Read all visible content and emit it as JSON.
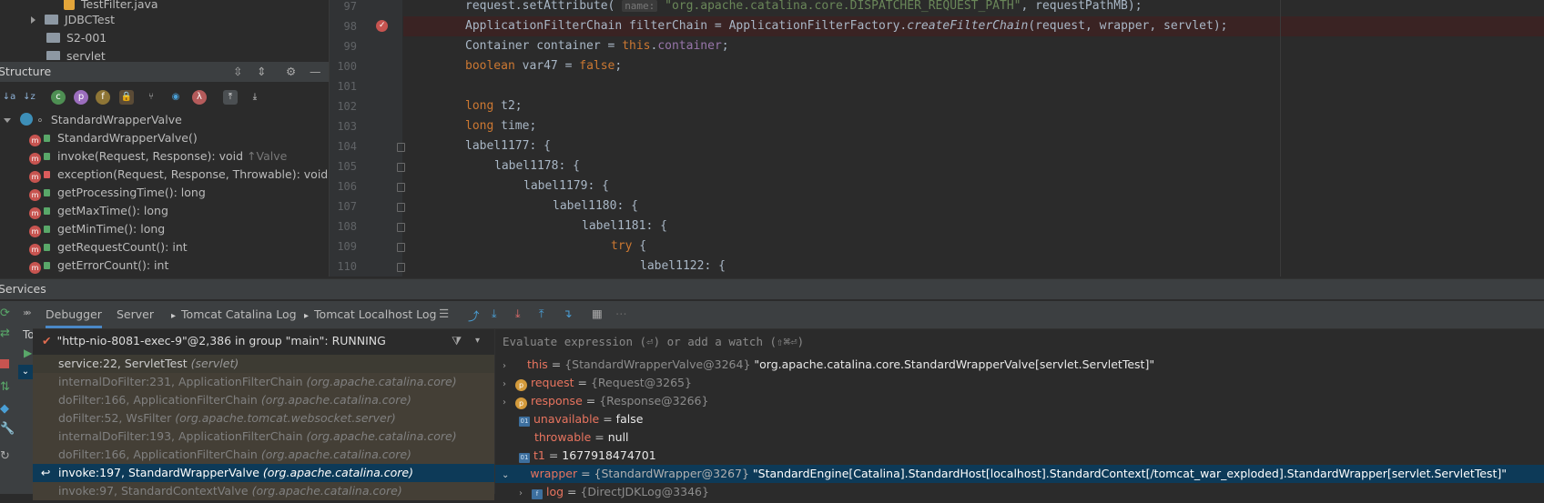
{
  "project_tree": [
    {
      "label": "TestFilter.java",
      "kind": "java-file"
    },
    {
      "label": "JDBCTest",
      "kind": "folder",
      "collapsed": true
    },
    {
      "label": "S2-001",
      "kind": "folder"
    },
    {
      "label": "servlet",
      "kind": "folder"
    }
  ],
  "structure": {
    "title": "Structure",
    "root": "StandardWrapperValve",
    "items": [
      {
        "label": "StandardWrapperValve()",
        "hint": "",
        "access": "public"
      },
      {
        "label": "invoke(Request, Response): void",
        "hint": "↑Valve",
        "access": "public"
      },
      {
        "label": "exception(Request, Response, Throwable): void",
        "hint": "",
        "access": "private"
      },
      {
        "label": "getProcessingTime(): long",
        "hint": "",
        "access": "public"
      },
      {
        "label": "getMaxTime(): long",
        "hint": "",
        "access": "public"
      },
      {
        "label": "getMinTime(): long",
        "hint": "",
        "access": "public"
      },
      {
        "label": "getRequestCount(): int",
        "hint": "",
        "access": "public"
      },
      {
        "label": "getErrorCount(): int",
        "hint": "",
        "access": "public"
      }
    ]
  },
  "editor": {
    "line_numbers": [
      "97",
      "98",
      "99",
      "100",
      "101",
      "102",
      "103",
      "104",
      "105",
      "106",
      "107",
      "108",
      "109",
      "110"
    ],
    "breakpoint_line": "98",
    "inlay_hint_name": "name:",
    "line97_str": "\"org.apache.catalina.core.DISPATCHER_REQUEST_PATH\"",
    "line97_rest": ", requestPathMB);",
    "line98_method": "createFilterChain",
    "line98_args": "(request, wrapper, servlet);",
    "labels": {
      "l1177": "label1177",
      "l1178": "label1178",
      "l1179": "label1179",
      "l1180": "label1180",
      "l1181": "label1181",
      "l1122": "label1122"
    }
  },
  "services": {
    "title": "Services",
    "tabs": [
      "Debugger",
      "Server",
      "Tomcat Catalina Log",
      "Tomcat Localhost Log"
    ],
    "active_tab": "Debugger",
    "side_label": "To"
  },
  "thread": {
    "label": "\"http-nio-8081-exec-9\"@2,386 in group \"main\": RUNNING"
  },
  "frames": [
    {
      "method": "service:22, ServletTest",
      "pkg": "(servlet)",
      "style": "user"
    },
    {
      "method": "internalDoFilter:231, ApplicationFilterChain",
      "pkg": "(org.apache.catalina.core)",
      "style": "lib"
    },
    {
      "method": "doFilter:166, ApplicationFilterChain",
      "pkg": "(org.apache.catalina.core)",
      "style": "lib"
    },
    {
      "method": "doFilter:52, WsFilter",
      "pkg": "(org.apache.tomcat.websocket.server)",
      "style": "lib"
    },
    {
      "method": "internalDoFilter:193, ApplicationFilterChain",
      "pkg": "(org.apache.catalina.core)",
      "style": "lib"
    },
    {
      "method": "doFilter:166, ApplicationFilterChain",
      "pkg": "(org.apache.catalina.core)",
      "style": "lib"
    },
    {
      "method": "invoke:197, StandardWrapperValve",
      "pkg": "(org.apache.catalina.core)",
      "style": "selected"
    },
    {
      "method": "invoke:97, StandardContextValve",
      "pkg": "(org.apache.catalina.core)",
      "style": "lib"
    }
  ],
  "watch": {
    "placeholder": "Evaluate expression (⏎) or add a watch (⇧⌘⏎)"
  },
  "variables": [
    {
      "name": "this",
      "type": "{StandardWrapperValve@3264}",
      "value": "\"org.apache.catalina.core.StandardWrapperValve[servlet.ServletTest]\"",
      "badge": "none",
      "expand": "right"
    },
    {
      "name": "request",
      "type": "{Request@3265}",
      "value": "",
      "badge": "p",
      "expand": "right"
    },
    {
      "name": "response",
      "type": "{Response@3266}",
      "value": "",
      "badge": "p",
      "expand": "right"
    },
    {
      "name": "unavailable",
      "type": "",
      "value": "false",
      "badge": "f",
      "expand": "none"
    },
    {
      "name": "throwable",
      "type": "",
      "value": "null",
      "badge": "none",
      "expand": "none"
    },
    {
      "name": "t1",
      "type": "",
      "value": "1677918474701",
      "badge": "f",
      "expand": "none"
    },
    {
      "name": "wrapper",
      "type": "{StandardWrapper@3267}",
      "value": "\"StandardEngine[Catalina].StandardHost[localhost].StandardContext[/tomcat_war_exploded].StandardWrapper[servlet.ServletTest]\"",
      "badge": "none",
      "expand": "down",
      "selected": true
    },
    {
      "name": "log",
      "type": "{DirectJDKLog@3346}",
      "value": "",
      "badge": "f",
      "expand": "right",
      "indent": true
    }
  ]
}
